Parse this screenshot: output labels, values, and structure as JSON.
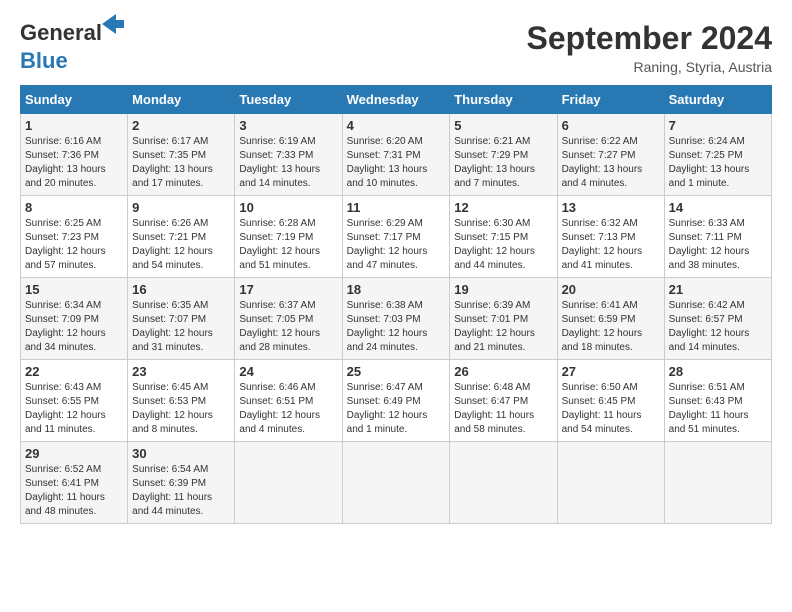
{
  "header": {
    "logo_line1": "General",
    "logo_line2": "Blue",
    "month_year": "September 2024",
    "location": "Raning, Styria, Austria"
  },
  "days_of_week": [
    "Sunday",
    "Monday",
    "Tuesday",
    "Wednesday",
    "Thursday",
    "Friday",
    "Saturday"
  ],
  "weeks": [
    [
      {
        "day": "1",
        "sunrise": "6:16 AM",
        "sunset": "7:36 PM",
        "daylight": "13 hours and 20 minutes."
      },
      {
        "day": "2",
        "sunrise": "6:17 AM",
        "sunset": "7:35 PM",
        "daylight": "13 hours and 17 minutes."
      },
      {
        "day": "3",
        "sunrise": "6:19 AM",
        "sunset": "7:33 PM",
        "daylight": "13 hours and 14 minutes."
      },
      {
        "day": "4",
        "sunrise": "6:20 AM",
        "sunset": "7:31 PM",
        "daylight": "13 hours and 10 minutes."
      },
      {
        "day": "5",
        "sunrise": "6:21 AM",
        "sunset": "7:29 PM",
        "daylight": "13 hours and 7 minutes."
      },
      {
        "day": "6",
        "sunrise": "6:22 AM",
        "sunset": "7:27 PM",
        "daylight": "13 hours and 4 minutes."
      },
      {
        "day": "7",
        "sunrise": "6:24 AM",
        "sunset": "7:25 PM",
        "daylight": "13 hours and 1 minute."
      }
    ],
    [
      {
        "day": "8",
        "sunrise": "6:25 AM",
        "sunset": "7:23 PM",
        "daylight": "12 hours and 57 minutes."
      },
      {
        "day": "9",
        "sunrise": "6:26 AM",
        "sunset": "7:21 PM",
        "daylight": "12 hours and 54 minutes."
      },
      {
        "day": "10",
        "sunrise": "6:28 AM",
        "sunset": "7:19 PM",
        "daylight": "12 hours and 51 minutes."
      },
      {
        "day": "11",
        "sunrise": "6:29 AM",
        "sunset": "7:17 PM",
        "daylight": "12 hours and 47 minutes."
      },
      {
        "day": "12",
        "sunrise": "6:30 AM",
        "sunset": "7:15 PM",
        "daylight": "12 hours and 44 minutes."
      },
      {
        "day": "13",
        "sunrise": "6:32 AM",
        "sunset": "7:13 PM",
        "daylight": "12 hours and 41 minutes."
      },
      {
        "day": "14",
        "sunrise": "6:33 AM",
        "sunset": "7:11 PM",
        "daylight": "12 hours and 38 minutes."
      }
    ],
    [
      {
        "day": "15",
        "sunrise": "6:34 AM",
        "sunset": "7:09 PM",
        "daylight": "12 hours and 34 minutes."
      },
      {
        "day": "16",
        "sunrise": "6:35 AM",
        "sunset": "7:07 PM",
        "daylight": "12 hours and 31 minutes."
      },
      {
        "day": "17",
        "sunrise": "6:37 AM",
        "sunset": "7:05 PM",
        "daylight": "12 hours and 28 minutes."
      },
      {
        "day": "18",
        "sunrise": "6:38 AM",
        "sunset": "7:03 PM",
        "daylight": "12 hours and 24 minutes."
      },
      {
        "day": "19",
        "sunrise": "6:39 AM",
        "sunset": "7:01 PM",
        "daylight": "12 hours and 21 minutes."
      },
      {
        "day": "20",
        "sunrise": "6:41 AM",
        "sunset": "6:59 PM",
        "daylight": "12 hours and 18 minutes."
      },
      {
        "day": "21",
        "sunrise": "6:42 AM",
        "sunset": "6:57 PM",
        "daylight": "12 hours and 14 minutes."
      }
    ],
    [
      {
        "day": "22",
        "sunrise": "6:43 AM",
        "sunset": "6:55 PM",
        "daylight": "12 hours and 11 minutes."
      },
      {
        "day": "23",
        "sunrise": "6:45 AM",
        "sunset": "6:53 PM",
        "daylight": "12 hours and 8 minutes."
      },
      {
        "day": "24",
        "sunrise": "6:46 AM",
        "sunset": "6:51 PM",
        "daylight": "12 hours and 4 minutes."
      },
      {
        "day": "25",
        "sunrise": "6:47 AM",
        "sunset": "6:49 PM",
        "daylight": "12 hours and 1 minute."
      },
      {
        "day": "26",
        "sunrise": "6:48 AM",
        "sunset": "6:47 PM",
        "daylight": "11 hours and 58 minutes."
      },
      {
        "day": "27",
        "sunrise": "6:50 AM",
        "sunset": "6:45 PM",
        "daylight": "11 hours and 54 minutes."
      },
      {
        "day": "28",
        "sunrise": "6:51 AM",
        "sunset": "6:43 PM",
        "daylight": "11 hours and 51 minutes."
      }
    ],
    [
      {
        "day": "29",
        "sunrise": "6:52 AM",
        "sunset": "6:41 PM",
        "daylight": "11 hours and 48 minutes."
      },
      {
        "day": "30",
        "sunrise": "6:54 AM",
        "sunset": "6:39 PM",
        "daylight": "11 hours and 44 minutes."
      },
      null,
      null,
      null,
      null,
      null
    ]
  ],
  "labels": {
    "sunrise": "Sunrise:",
    "sunset": "Sunset:",
    "daylight": "Daylight:"
  }
}
